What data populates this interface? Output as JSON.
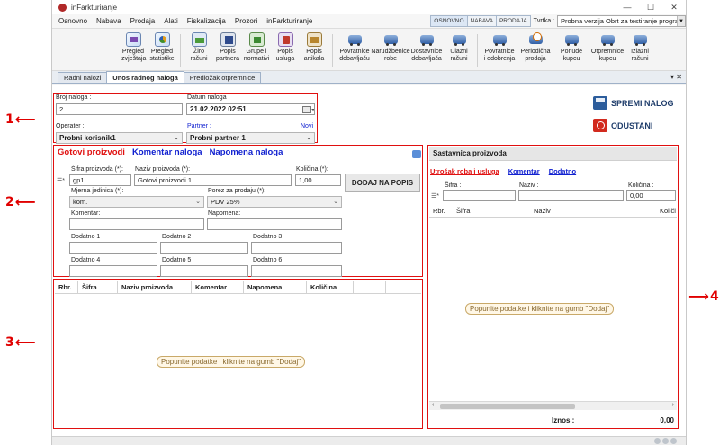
{
  "callouts": [
    "1",
    "2",
    "3",
    "4"
  ],
  "window": {
    "title": "inFarkturiranje",
    "controls": [
      "—",
      "☐",
      "✕"
    ]
  },
  "menu": {
    "items": [
      "Osnovno",
      "Nabava",
      "Prodaja",
      "Alati",
      "Fiskalizacija",
      "Prozori",
      "inFarkturiranje"
    ],
    "modes": [
      "OSNOVNO",
      "NABAVA",
      "PRODAJA"
    ],
    "company_label": "Tvrtka :",
    "company_value": "Probna verzija Obrt za testiranje programa"
  },
  "ribbon": {
    "group1": [
      {
        "line1": "Pregled",
        "line2": "izvještaja"
      },
      {
        "line1": "Pregled",
        "line2": "statistike"
      }
    ],
    "group2": [
      {
        "line1": "Žiro",
        "line2": "računi"
      },
      {
        "line1": "Popis",
        "line2": "partnera"
      },
      {
        "line1": "Grupe i",
        "line2": "normativi"
      },
      {
        "line1": "Popis",
        "line2": "usluga"
      },
      {
        "line1": "Popis",
        "line2": "artikala"
      }
    ],
    "group3": [
      {
        "line1": "Povratnice",
        "line2": "dobavljaču"
      },
      {
        "line1": "Narudžbenice",
        "line2": "robe"
      },
      {
        "line1": "Dostavnice",
        "line2": "dobavljača"
      },
      {
        "line1": "Ulazni",
        "line2": "računi"
      }
    ],
    "group4": [
      {
        "line1": "Povratnice",
        "line2": "i odobrenja"
      },
      {
        "line1": "Periodična",
        "line2": "prodaja"
      },
      {
        "line1": "Ponude",
        "line2": "kupcu"
      },
      {
        "line1": "Otpremnice",
        "line2": "kupcu"
      },
      {
        "line1": "Izlazni",
        "line2": "računi"
      }
    ]
  },
  "doc_tabs": [
    "Radni nalozi",
    "Unos radnog naloga",
    "Predložak otpremnice"
  ],
  "doc_tabs_close": "▾ ✕",
  "header_form": {
    "broj_label": "Broj naloga :",
    "broj_value": "2",
    "datum_label": "Datum naloga :",
    "datum_value": "21.02.2022 02:51",
    "operater_label": "Operater :",
    "operater_value": "Probni korisnik1",
    "partner_label": "Partner :",
    "novi_link": "Novi",
    "partner_value": "Probni partner 1"
  },
  "actions": {
    "save": "SPREMI NALOG",
    "cancel": "ODUSTANI"
  },
  "entry": {
    "tabs": [
      "Gotovi proizvodi",
      "Komentar naloga",
      "Napomena naloga"
    ],
    "sifra_label": "Šifra proizvoda (*):",
    "sifra_value": "gp1",
    "naziv_label": "Naziv proizvoda (*):",
    "naziv_value": "Gotovi proizvodi 1",
    "kolicina_label": "Količina (*):",
    "kolicina_value": "1,00",
    "add_button": "DODAJ NA POPIS",
    "mjera_label": "Mjerna jedinica (*):",
    "mjera_value": "kom.",
    "porez_label": "Porez za prodaju (*):",
    "porez_value": "PDV 25%",
    "komentar_label": "Komentar:",
    "napomena_label": "Napomena:",
    "dodatno": [
      "Dodatno 1",
      "Dodatno 2",
      "Dodatno 3",
      "Dodatno 4",
      "Dodatno 5",
      "Dodatno 6"
    ],
    "row_marker": "☰*"
  },
  "grid": {
    "columns": [
      "Rbr.",
      "Šifra",
      "Naziv proizvoda",
      "Komentar",
      "Napomena",
      "Količina"
    ],
    "empty_hint": "Popunite podatke i kliknite na gumb \"Dodaj\""
  },
  "sastavnica": {
    "title": "Sastavnica proizvoda",
    "links": [
      "Utrošak roba i usluga",
      "Komentar",
      "Dodatno"
    ],
    "sifra_label": "Šifra :",
    "naziv_label": "Naziv :",
    "kolicina_label": "Količina :",
    "kolicina_value": "0,00",
    "row_marker": "☰*",
    "columns": [
      "Rbr.",
      "Šifra",
      "Naziv",
      "Količi"
    ],
    "empty_hint": "Popunite podatke i kliknite na gumb \"Dodaj\"",
    "scroll_left": "‹",
    "scroll_right": "›",
    "total_label": "Iznos :",
    "total_value": "0,00"
  },
  "colors": {
    "callout": "#e00000",
    "link_blue": "#1020d0",
    "active_red": "#e01010"
  }
}
